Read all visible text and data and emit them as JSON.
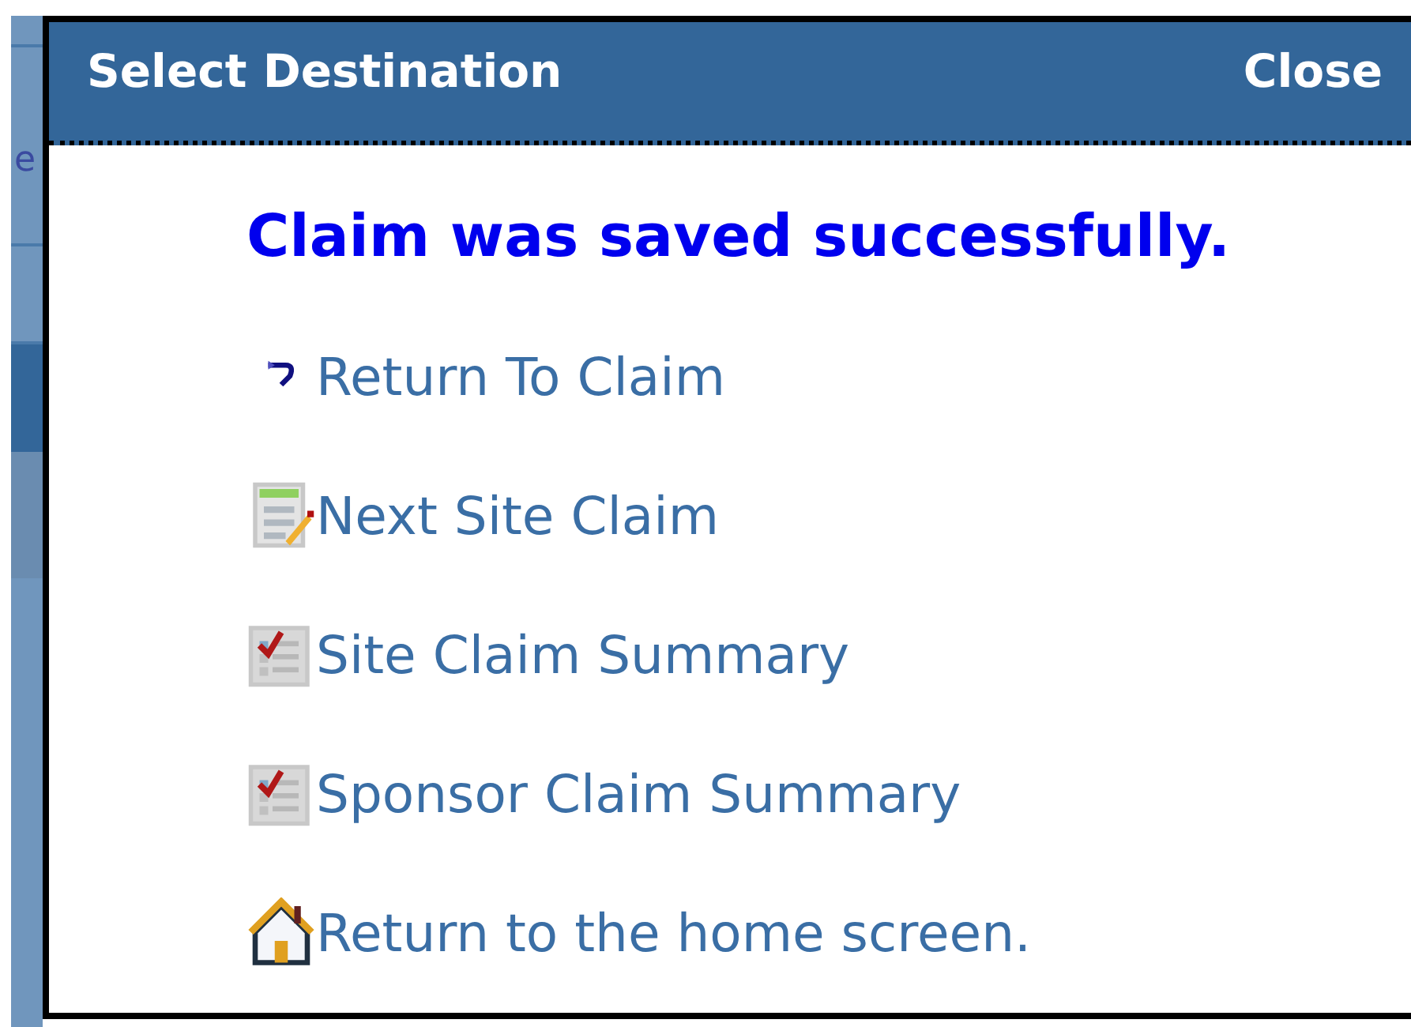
{
  "background": {
    "fragment": "e"
  },
  "dialog": {
    "title": "Select Destination",
    "close": "Close",
    "message": "Claim was saved successfully.",
    "links": [
      {
        "kind": "back",
        "label": "Return To Claim"
      },
      {
        "kind": "edit",
        "label": "Next Site Claim"
      },
      {
        "kind": "checklist",
        "label": "Site Claim Summary"
      },
      {
        "kind": "checklist",
        "label": "Sponsor Claim Summary"
      },
      {
        "kind": "home",
        "label": "Return to the home screen."
      }
    ]
  }
}
